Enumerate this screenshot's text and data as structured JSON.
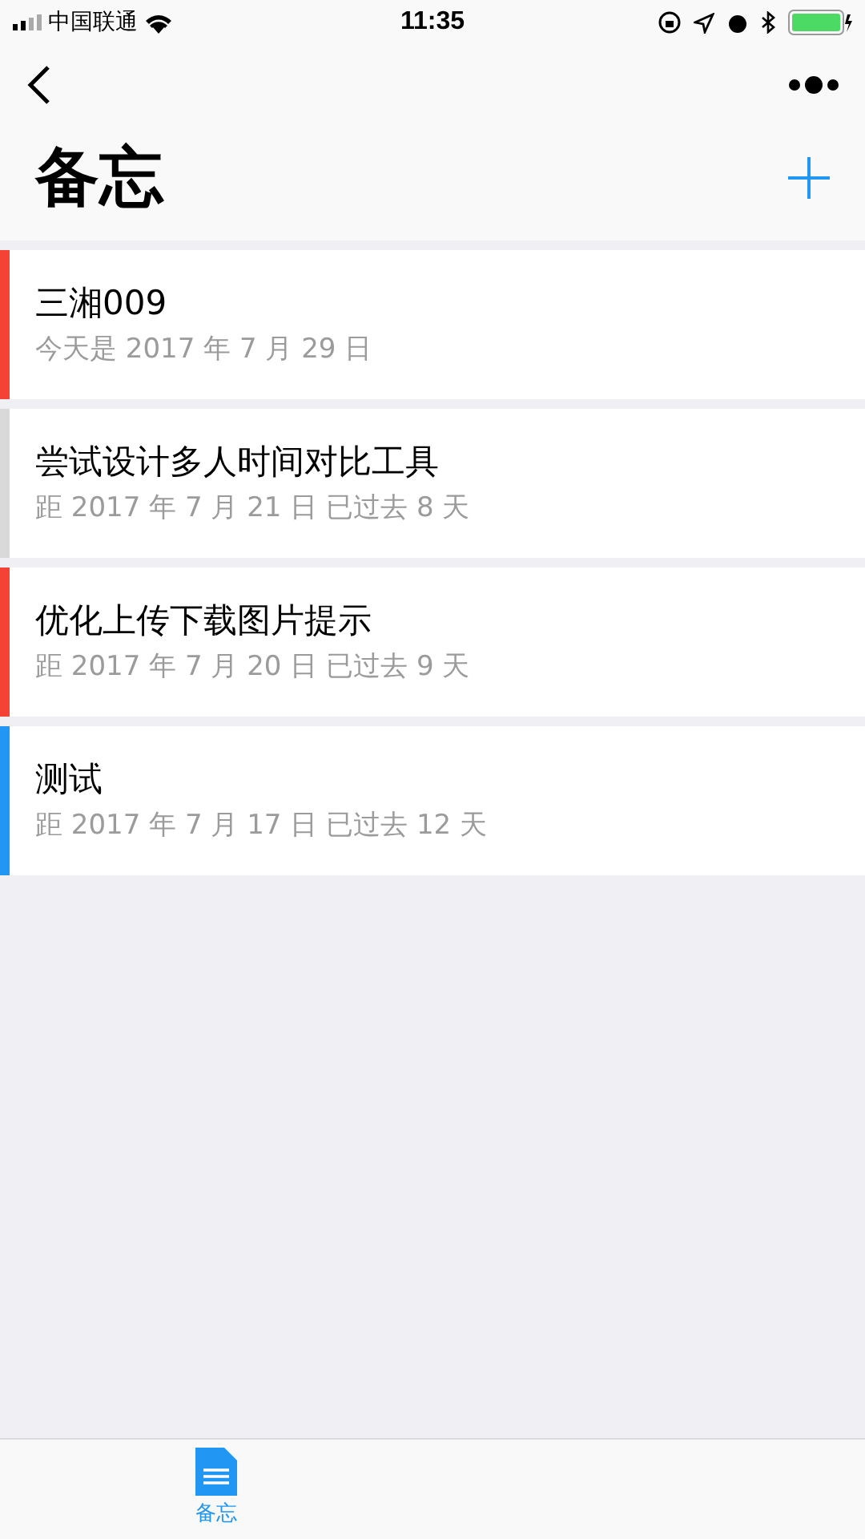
{
  "status_bar": {
    "carrier": "中国联通",
    "time": "11:35"
  },
  "title": "备忘",
  "memos": [
    {
      "title": "三湘009",
      "subtitle": "今天是 2017 年 7 月 29 日",
      "color": "#f44336"
    },
    {
      "title": "尝试设计多人时间对比工具",
      "subtitle": "距 2017 年 7 月 21 日 已过去 8 天",
      "color": "#d9d9d9"
    },
    {
      "title": "优化上传下载图片提示",
      "subtitle": "距 2017 年 7 月 20 日 已过去 9 天",
      "color": "#f44336"
    },
    {
      "title": "测试",
      "subtitle": "距 2017 年 7 月 17 日 已过去 12 天",
      "color": "#2196f3"
    }
  ],
  "tab_bar": [
    {
      "label": "备忘",
      "selected": true
    }
  ]
}
